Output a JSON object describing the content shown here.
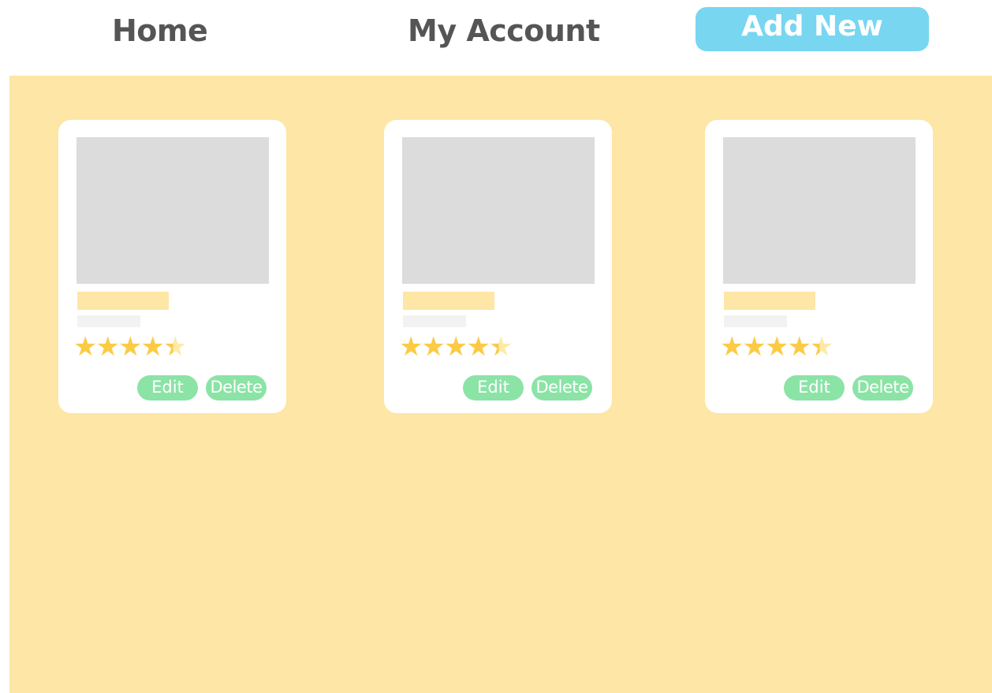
{
  "nav": {
    "home_label": "Home",
    "account_label": "My Account",
    "add_new_label": "Add New"
  },
  "colors": {
    "accent_blue": "#78d6f1",
    "background_yellow": "#fde6a6",
    "button_green": "#8be3a6",
    "star_gold": "#fccb45"
  },
  "cards": [
    {
      "rating": 4.5,
      "edit_label": "Edit",
      "delete_label": "Delete"
    },
    {
      "rating": 4.5,
      "edit_label": "Edit",
      "delete_label": "Delete"
    },
    {
      "rating": 4.5,
      "edit_label": "Edit",
      "delete_label": "Delete"
    }
  ]
}
